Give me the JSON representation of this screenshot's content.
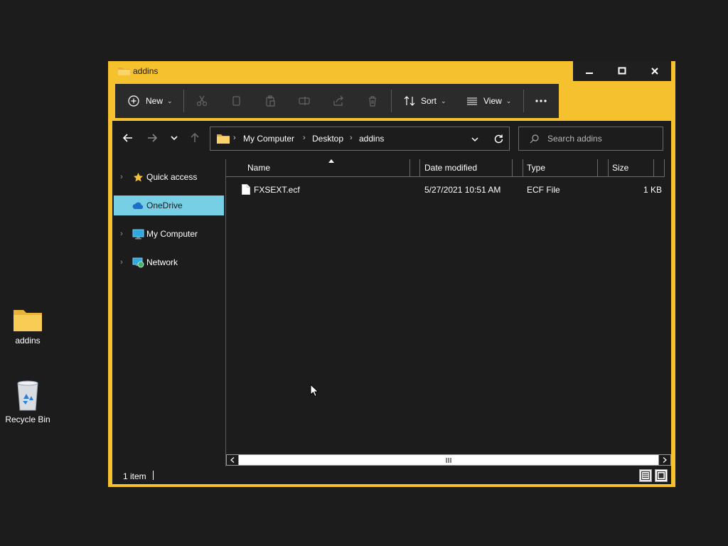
{
  "desktop": {
    "icons": [
      {
        "label": "addins",
        "icon": "folder-icon"
      },
      {
        "label": "Recycle Bin",
        "icon": "recycle-bin-icon"
      }
    ]
  },
  "window": {
    "title": "addins",
    "caption_buttons": [
      "minimize",
      "maximize",
      "close"
    ]
  },
  "toolbar": {
    "new_label": "New",
    "sort_label": "Sort",
    "view_label": "View",
    "icons": [
      "cut-icon",
      "copy-icon",
      "paste-icon",
      "rename-icon",
      "share-icon",
      "delete-icon",
      "more-icon"
    ]
  },
  "address": {
    "breadcrumbs": [
      "My Computer",
      "Desktop",
      "addins"
    ],
    "search_placeholder": "Search addins"
  },
  "nav_pane": {
    "items": [
      {
        "label": "Quick access",
        "icon": "star-icon",
        "selected": false
      },
      {
        "label": "OneDrive",
        "icon": "cloud-icon",
        "selected": true
      },
      {
        "label": "My Computer",
        "icon": "monitor-icon",
        "selected": false
      },
      {
        "label": "Network",
        "icon": "network-icon",
        "selected": false
      }
    ]
  },
  "file_list": {
    "columns": [
      "Name",
      "Date modified",
      "Type",
      "Size"
    ],
    "rows": [
      {
        "name": "FXSEXT.ecf",
        "date_modified": "5/27/2021 10:51 AM",
        "type": "ECF File",
        "size": "1 KB"
      }
    ]
  },
  "status_bar": {
    "item_count": "1 item"
  },
  "colors": {
    "window_accent": "#f5c12e",
    "selection": "#77cfe6",
    "background": "#1c1c1c"
  }
}
